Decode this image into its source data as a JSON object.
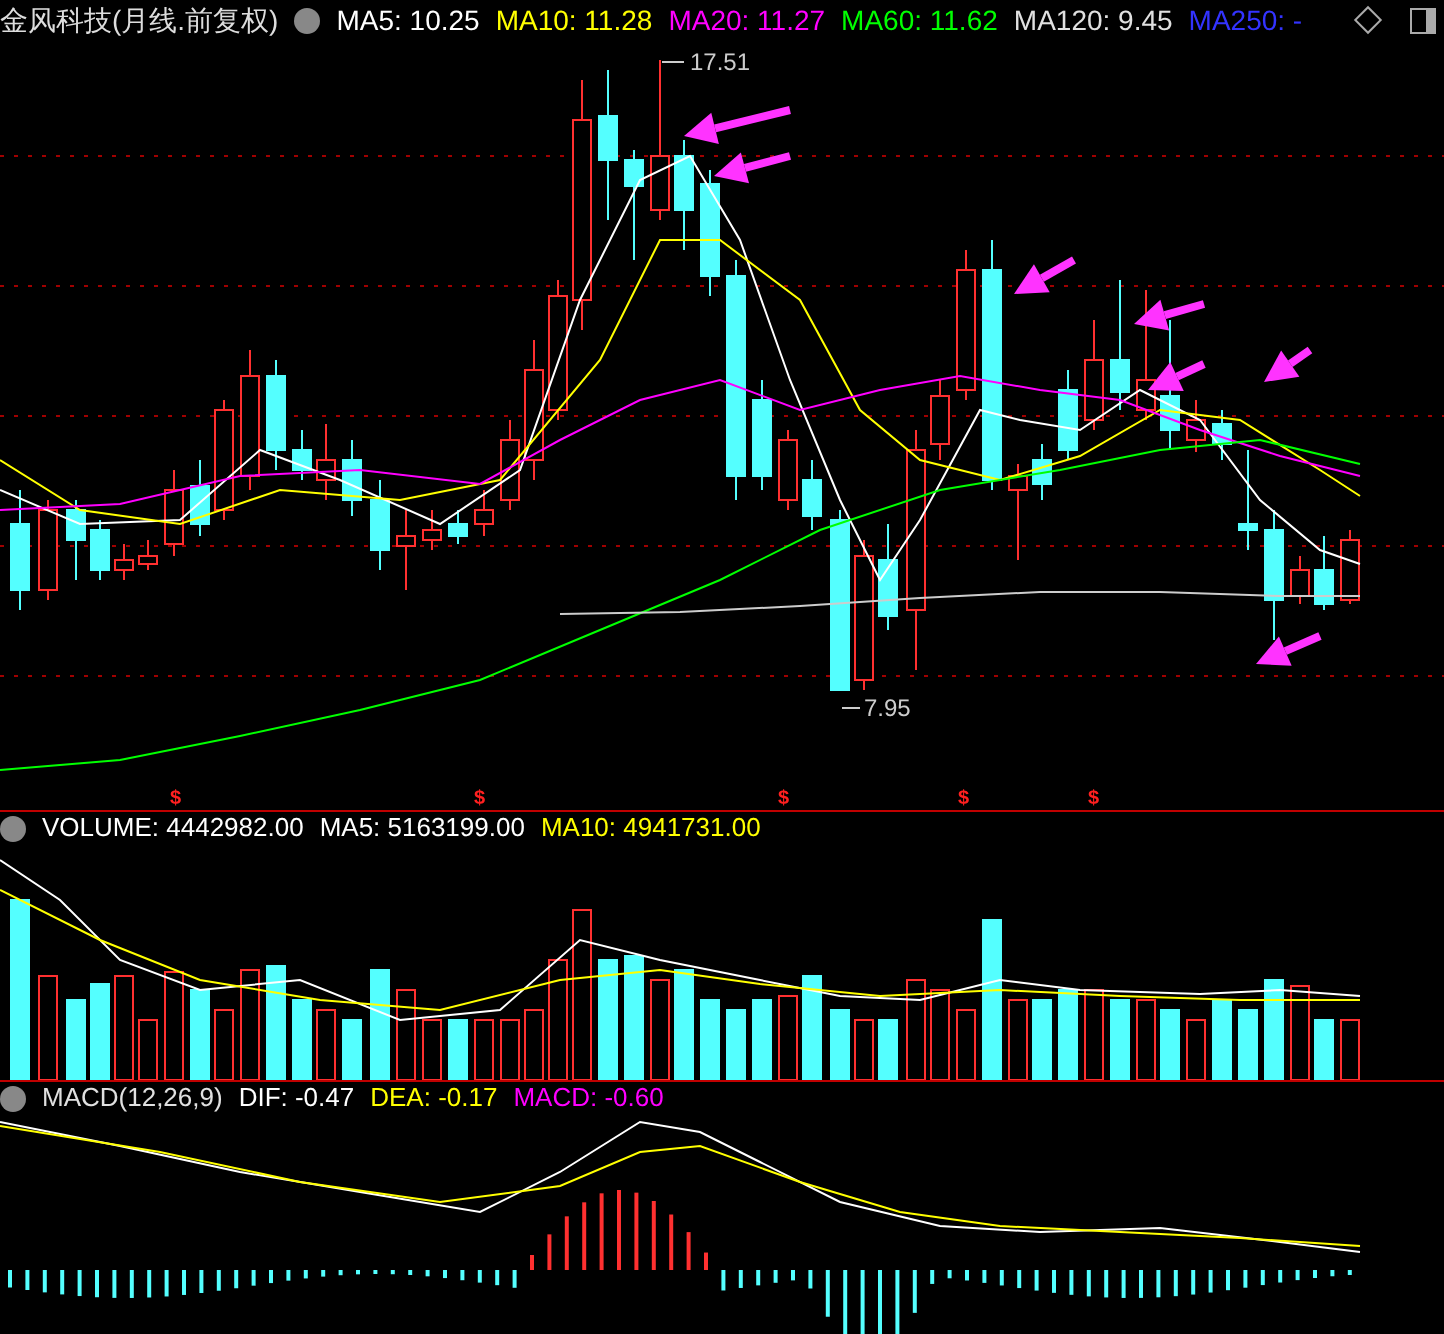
{
  "header": {
    "title": "金风科技(月线.前复权)",
    "ma_legend": [
      {
        "label": "MA5: 10.25",
        "color": "#ffffff"
      },
      {
        "label": "MA10: 11.28",
        "color": "#ffff00"
      },
      {
        "label": "MA20: 11.27",
        "color": "#ff00ff"
      },
      {
        "label": "MA60: 11.62",
        "color": "#00ff00"
      },
      {
        "label": "MA120: 9.45",
        "color": "#e0e0e0"
      },
      {
        "label": "MA250: -",
        "color": "#3333ff"
      }
    ]
  },
  "price_panel": {
    "high_label": "17.51",
    "low_label": "7.95",
    "markers": [
      "$",
      "$",
      "$",
      "$",
      "$"
    ]
  },
  "volume_panel": {
    "legend": [
      {
        "label": "VOLUME: 4442982.00",
        "color": "#ffffff"
      },
      {
        "label": "MA5: 5163199.00",
        "color": "#ffffff"
      },
      {
        "label": "MA10: 4941731.00",
        "color": "#ffff00"
      }
    ]
  },
  "macd_panel": {
    "legend": [
      {
        "label": "MACD(12,26,9)",
        "color": "#e0e0e0"
      },
      {
        "label": "DIF: -0.47",
        "color": "#ffffff"
      },
      {
        "label": "DEA: -0.17",
        "color": "#ffff00"
      },
      {
        "label": "MACD: -0.60",
        "color": "#ff00ff"
      }
    ]
  }
}
